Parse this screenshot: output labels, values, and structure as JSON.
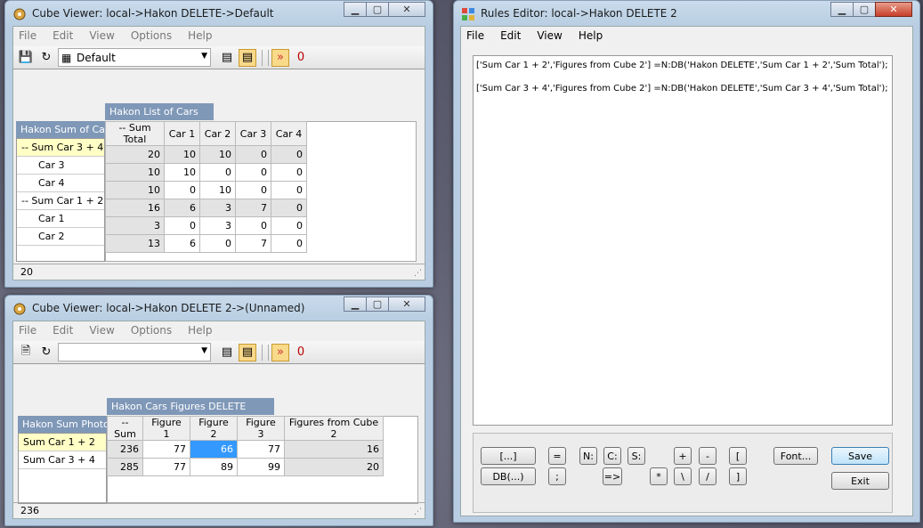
{
  "cube1": {
    "title": "Cube Viewer: local->Hakon DELETE->Default",
    "menu": [
      "File",
      "Edit",
      "View",
      "Options",
      "Help"
    ],
    "view_name": "Default",
    "column_dimension": "Hakon List of Cars",
    "row_dimension": "Hakon Sum of Cars",
    "columns": [
      "-- Sum Total",
      "Car 1",
      "Car 2",
      "Car 3",
      "Car 4"
    ],
    "rows": [
      {
        "label": "-- Sum Car 3 + 4",
        "values": [
          "20",
          "10",
          "10",
          "0",
          "0"
        ]
      },
      {
        "label": "Car 3",
        "values": [
          "10",
          "10",
          "0",
          "0",
          "0"
        ]
      },
      {
        "label": "Car 4",
        "values": [
          "10",
          "0",
          "10",
          "0",
          "0"
        ]
      },
      {
        "label": "-- Sum Car 1 + 2",
        "values": [
          "16",
          "6",
          "3",
          "7",
          "0"
        ]
      },
      {
        "label": "Car 1",
        "values": [
          "3",
          "0",
          "3",
          "0",
          "0"
        ]
      },
      {
        "label": "Car 2",
        "values": [
          "13",
          "6",
          "0",
          "7",
          "0"
        ]
      }
    ],
    "status": "20"
  },
  "cube2": {
    "title": "Cube Viewer: local->Hakon DELETE 2->(Unnamed)",
    "menu": [
      "File",
      "Edit",
      "View",
      "Options",
      "Help"
    ],
    "view_name": "",
    "column_dimension": "Hakon Cars Figures DELETE",
    "row_dimension": "Hakon Sum Photos",
    "columns": [
      "-- Sum",
      "Figure 1",
      "Figure 2",
      "Figure 3",
      "Figures from Cube 2"
    ],
    "rows": [
      {
        "label": "Sum Car 1 + 2",
        "values": [
          "236",
          "77",
          "66",
          "77",
          "16"
        ]
      },
      {
        "label": "Sum Car 3 + 4",
        "values": [
          "285",
          "77",
          "89",
          "99",
          "20"
        ]
      }
    ],
    "status": "236"
  },
  "rules": {
    "title": "Rules Editor:  local->Hakon DELETE 2",
    "menu": [
      "File",
      "Edit",
      "View",
      "Help"
    ],
    "lines": [
      "['Sum Car 1 + 2','Figures from Cube 2']  =N:DB('Hakon DELETE','Sum Car 1 + 2','Sum Total');",
      "['Sum Car 3 + 4','Figures from Cube 2']  =N:DB('Hakon DELETE','Sum Car 3 + 4','Sum Total');"
    ],
    "buttons": {
      "bracket": "[...]",
      "eq": "=",
      "n": "N:",
      "c": "C:",
      "s": "S:",
      "plus": "+",
      "minus": "-",
      "lbr": "[",
      "db": "DB(...)",
      "semi": ";",
      "arrow": "=>",
      "mul": "*",
      "bslash": "\\",
      "slash": "/",
      "rbr": "]",
      "font": "Font...",
      "save": "Save",
      "exit": "Exit"
    }
  }
}
